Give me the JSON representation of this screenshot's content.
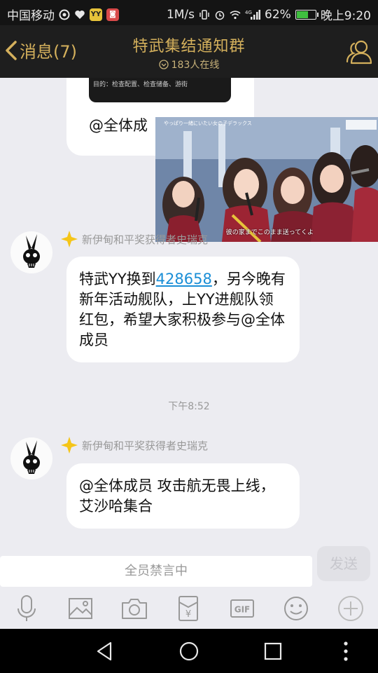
{
  "status_bar": {
    "carrier": "中国移动",
    "speed": "1M/s",
    "network": "4G",
    "battery": "62%",
    "battery_level": 0.62,
    "time": "晚上9:20",
    "badge_yy": "YY"
  },
  "header": {
    "back_label": "消息(7)",
    "title": "特武集结通知群",
    "online": "183人在线"
  },
  "messages": {
    "first_card_text": "目的：检查配置、检查储备、游街",
    "first_text": "@全体成",
    "photo_caption": "彼の家までこのまま送ってくよ",
    "photo_top": "やっぱり一緒にいたい女の子デラックス",
    "msg1": {
      "sender": "新伊甸和平奖获得者史瑞克",
      "text_before": "特武YY换到",
      "link": "428658",
      "text_after": "，另今晚有新年活动舰队，上YY进舰队领红包，希望大家积极参与@全体成员"
    },
    "time_divider": "下午8:52",
    "msg2": {
      "sender": "新伊甸和平奖获得者史瑞克",
      "text": "@全体成员 攻击航无畏上线，艾沙哈集合"
    }
  },
  "input": {
    "muted_text": "全员禁言中",
    "send_label": "发送"
  },
  "toolbar": {
    "gif_label": "GIF",
    "red_packet_label": "¥"
  },
  "colors": {
    "accent_gold": "#d4b05c",
    "header_bg": "#1e1e1e",
    "link": "#1a8ed6",
    "chat_bg": "#ececf1"
  }
}
